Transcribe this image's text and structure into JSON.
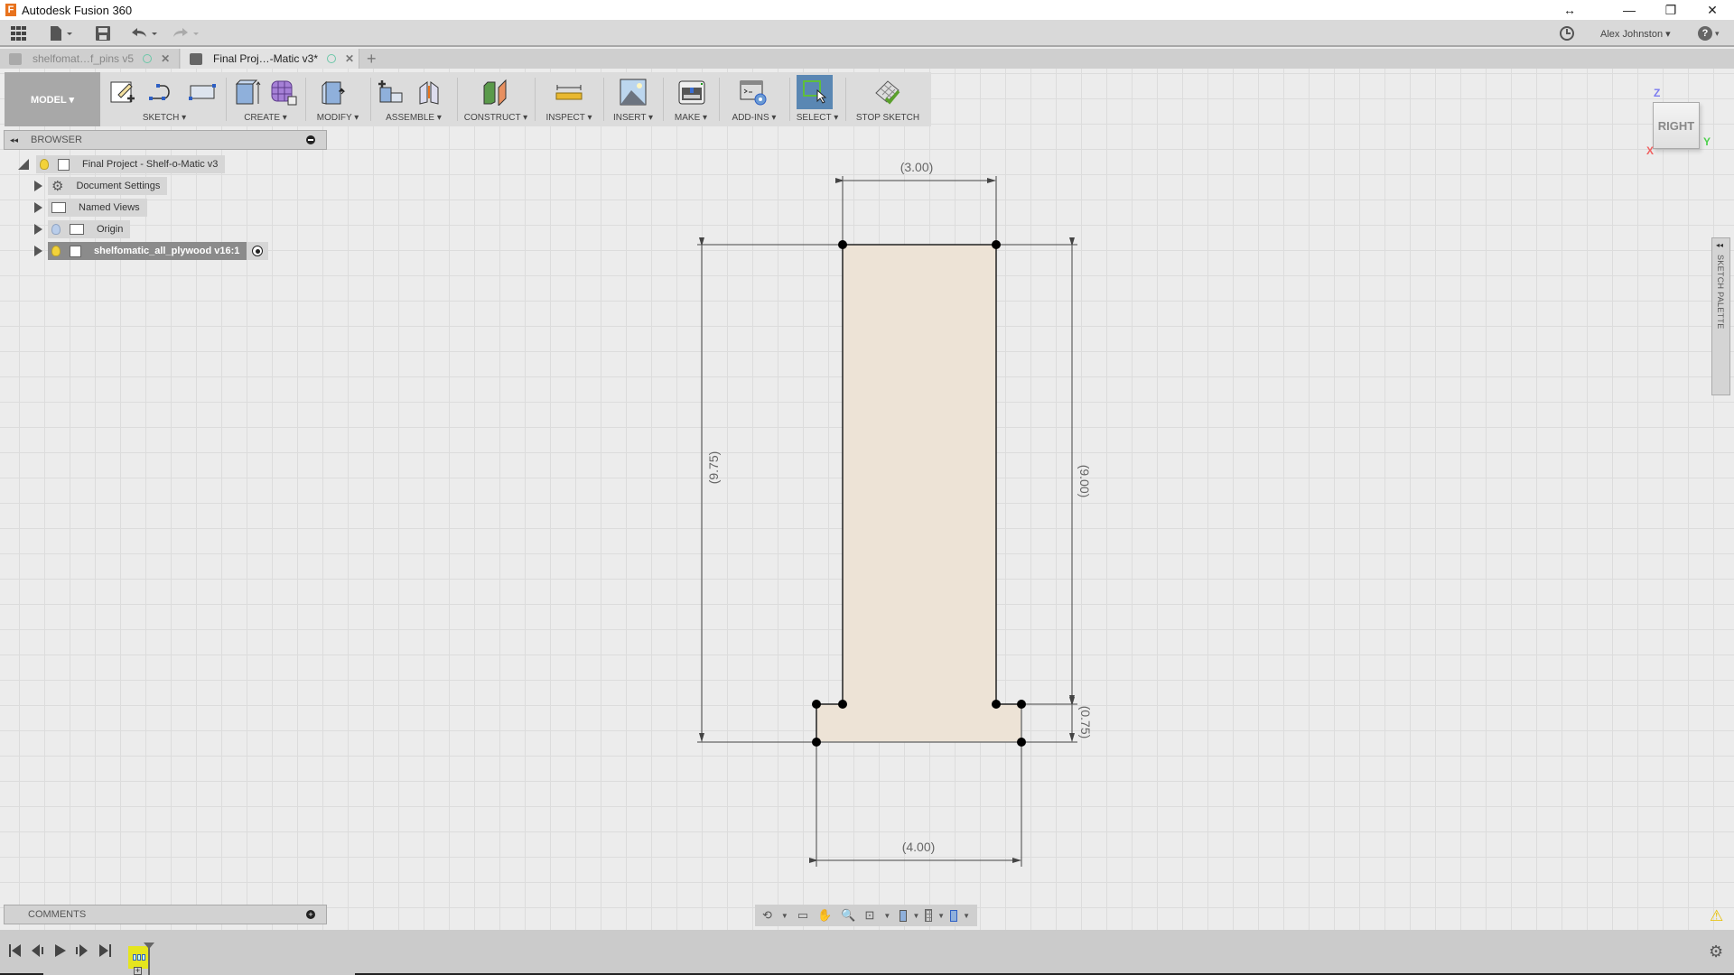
{
  "app": {
    "title": "Autodesk Fusion 360",
    "logo_letter": "F"
  },
  "window_controls": {
    "resize": "↔",
    "minimize": "—",
    "maximize": "❐",
    "close": "✕"
  },
  "quick_access": {
    "user": "Alex Johnston ▾",
    "help": "?",
    "help_caret": "▾",
    "clock_icon": "clock-icon"
  },
  "tabs": [
    {
      "label": "shelfomat…f_pins v5",
      "active": false
    },
    {
      "label": "Final Proj…-Matic v3*",
      "active": true
    }
  ],
  "new_tab": "+",
  "toolbar": {
    "workspace": "MODEL ▾",
    "groups": [
      {
        "label": "SKETCH ▾"
      },
      {
        "label": "CREATE ▾"
      },
      {
        "label": "MODIFY ▾"
      },
      {
        "label": "ASSEMBLE ▾"
      },
      {
        "label": "CONSTRUCT ▾"
      },
      {
        "label": "INSPECT ▾"
      },
      {
        "label": "INSERT ▾"
      },
      {
        "label": "MAKE ▾"
      },
      {
        "label": "ADD-INS ▾"
      },
      {
        "label": "SELECT ▾"
      },
      {
        "label": "STOP SKETCH"
      }
    ]
  },
  "browser": {
    "title": "BROWSER",
    "collapse": "◂◂",
    "items": [
      {
        "label": "Final Project - Shelf-o-Matic v3"
      },
      {
        "label": "Document Settings"
      },
      {
        "label": "Named Views"
      },
      {
        "label": "Origin"
      },
      {
        "label": "shelfomatic_all_plywood v16:1"
      }
    ]
  },
  "comments": {
    "title": "COMMENTS"
  },
  "viewcube": {
    "face": "RIGHT",
    "axis_z": "Z",
    "axis_y": "Y",
    "axis_x": "X"
  },
  "sketch_palette": {
    "label": "SKETCH PALETTE",
    "collapse": "◂◂"
  },
  "sketch": {
    "dimensions": {
      "top_width": "(3.00)",
      "bottom_width": "(4.00)",
      "left_height": "(9.75)",
      "right_height": "(9.00)",
      "base_height": "(0.75)"
    },
    "fill_color": "#ede3d6"
  },
  "navbar": {
    "orbit": "⟲",
    "look_at": "▭",
    "pan": "✋",
    "zoom": "🔍",
    "fit": "⊡"
  },
  "timeline": {
    "first": "⏮",
    "prev": "◂",
    "play": "▶",
    "next": "▸",
    "last": "⏭",
    "feature_color": "#e5e51e"
  },
  "status": {
    "warning": "⚠",
    "settings": "⚙"
  }
}
